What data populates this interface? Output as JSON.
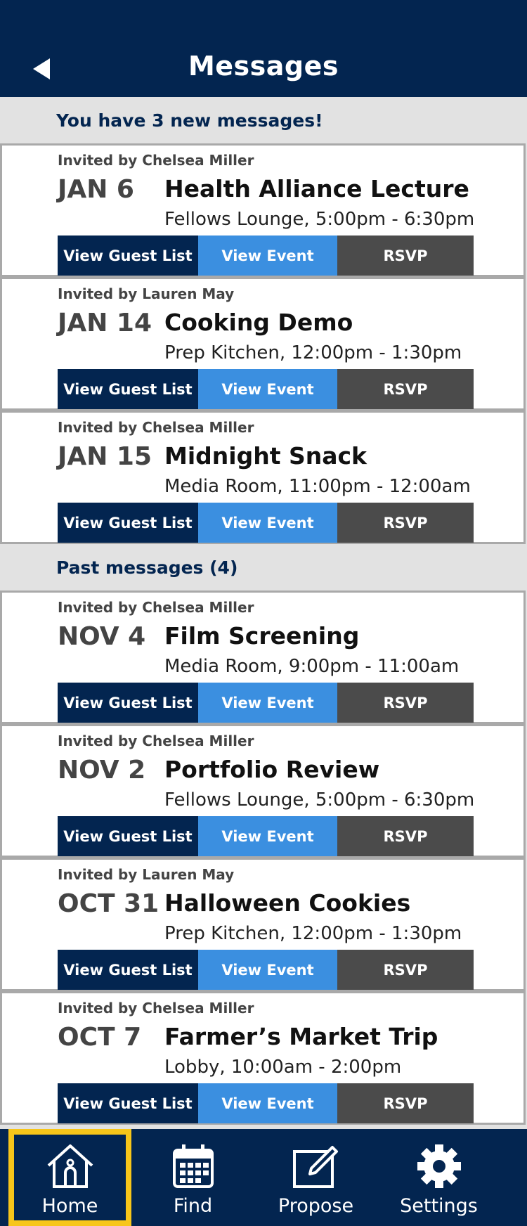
{
  "header": {
    "title": "Messages"
  },
  "new_section": {
    "banner": "You have 3 new messages!"
  },
  "new_messages": [
    {
      "invited": "Invited by Chelsea Miller",
      "date": "JAN 6",
      "title": "Health Alliance Lecture",
      "subtitle": "Fellows Lounge, 5:00pm - 6:30pm"
    },
    {
      "invited": "Invited by Lauren May",
      "date": "JAN 14",
      "title": "Cooking Demo",
      "subtitle": "Prep Kitchen, 12:00pm - 1:30pm"
    },
    {
      "invited": "Invited by Chelsea Miller",
      "date": "JAN 15",
      "title": "Midnight Snack",
      "subtitle": "Media Room, 11:00pm - 12:00am"
    }
  ],
  "past_section": {
    "banner": "Past messages (4)"
  },
  "past_messages": [
    {
      "invited": "Invited by Chelsea Miller",
      "date": "NOV 4",
      "title": "Film Screening",
      "subtitle": "Media Room, 9:00pm - 11:00am"
    },
    {
      "invited": "Invited by Chelsea Miller",
      "date": "NOV 2",
      "title": "Portfolio Review",
      "subtitle": "Fellows Lounge, 5:00pm - 6:30pm"
    },
    {
      "invited": "Invited by Lauren May",
      "date": "OCT 31",
      "title": "Halloween Cookies",
      "subtitle": "Prep Kitchen, 12:00pm - 1:30pm"
    },
    {
      "invited": "Invited by Chelsea Miller",
      "date": "OCT 7",
      "title": "Farmer’s Market Trip",
      "subtitle": "Lobby, 10:00am - 2:00pm"
    }
  ],
  "buttons": {
    "guest_list": "View Guest List",
    "view_event": "View Event",
    "rsvp": "RSVP"
  },
  "tabbar": {
    "tabs": [
      {
        "label": "Home",
        "icon": "home-icon",
        "active": true
      },
      {
        "label": "Find",
        "icon": "calendar-icon",
        "active": false
      },
      {
        "label": "Propose",
        "icon": "edit-icon",
        "active": false
      },
      {
        "label": "Settings",
        "icon": "gear-icon",
        "active": false
      }
    ]
  },
  "colors": {
    "navy": "#032550",
    "blue": "#3b8fe0",
    "gray": "#4b4b4b",
    "highlight": "#f7c61a"
  }
}
